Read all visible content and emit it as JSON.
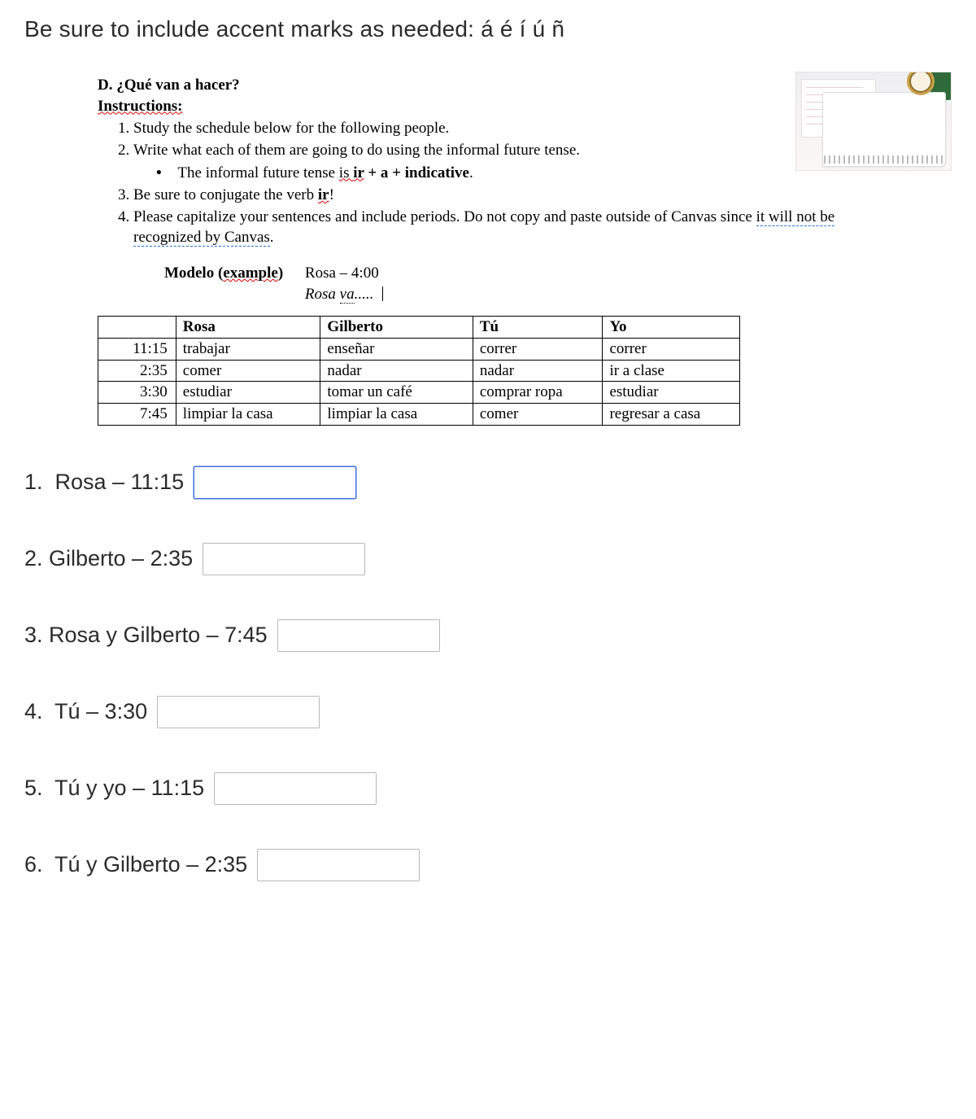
{
  "top_note": "Be sure to include accent marks as needed: á é í ú ñ",
  "section": {
    "heading": "D. ¿Qué van a hacer?",
    "instructions_label": "Instructions:",
    "items": [
      "Study the schedule below for the following people.",
      "Write what each of them are going to do using the informal future tense.",
      "Be sure to conjugate the verb ",
      "Please capitalize your sentences and include periods. Do not copy and paste outside of Canvas since "
    ],
    "item2_sub": "The informal future tense ",
    "item2_sub_is": "is ",
    "item2_sub_ir": "ir",
    "item2_sub_rest": " + a + indicative",
    "item3_ir": "ir",
    "item4_tail": "it will not be recognized by Canvas"
  },
  "modelo": {
    "label": "Modelo (",
    "example": "example",
    "close": ")",
    "row1": "Rosa – 4:00",
    "row2_prefix": "Rosa ",
    "row2_va": "va",
    "row2_dots": "....."
  },
  "table": {
    "headers": [
      "",
      "Rosa",
      "Gilberto",
      "Tú",
      "Yo"
    ],
    "rows": [
      [
        "11:15",
        "trabajar",
        "enseñar",
        "correr",
        "correr"
      ],
      [
        "2:35",
        "comer",
        "nadar",
        "nadar",
        "ir a clase"
      ],
      [
        "3:30",
        "estudiar",
        "tomar un café",
        "comprar ropa",
        "estudiar"
      ],
      [
        "7:45",
        "limpiar la casa",
        "limpiar la casa",
        "comer",
        "regresar a casa"
      ]
    ]
  },
  "questions": [
    {
      "label": "1.  Rosa – 11:15",
      "focused": true
    },
    {
      "label": "2. Gilberto – 2:35",
      "focused": false
    },
    {
      "label": "3. Rosa y Gilberto – 7:45",
      "focused": false
    },
    {
      "label": "4.  Tú – 3:30",
      "focused": false
    },
    {
      "label": "5.  Tú y yo – 11:15",
      "focused": false
    },
    {
      "label": "6.  Tú y Gilberto – 2:35",
      "focused": false
    }
  ]
}
